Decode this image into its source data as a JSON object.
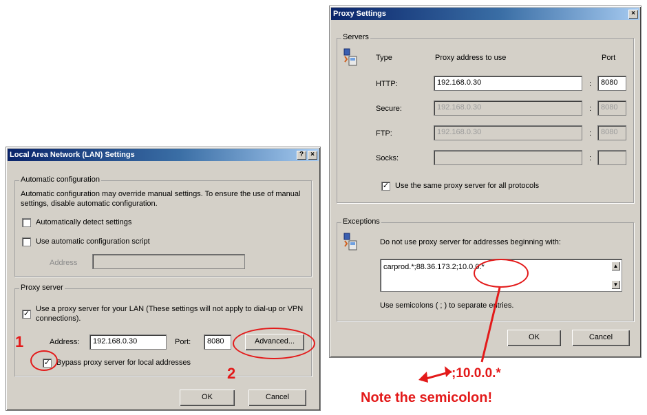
{
  "lan_dialog": {
    "title": "Local Area Network (LAN) Settings",
    "help_btn": "?",
    "close_btn": "×",
    "auto_config": {
      "group_label": "Automatic configuration",
      "description": "Automatic configuration may override manual settings.  To ensure the use of manual settings, disable automatic configuration.",
      "auto_detect_label": "Automatically detect settings",
      "auto_detect_checked": false,
      "use_script_label": "Use automatic configuration script",
      "use_script_checked": false,
      "address_label": "Address",
      "address_value": ""
    },
    "proxy_server": {
      "group_label": "Proxy server",
      "use_proxy_label": "Use a proxy server for your LAN (These settings will not apply to dial-up or VPN connections).",
      "use_proxy_checked": true,
      "address_label": "Address:",
      "address_value": "192.168.0.30",
      "port_label": "Port:",
      "port_value": "8080",
      "advanced_button": "Advanced...",
      "bypass_label": "Bypass proxy server for local addresses",
      "bypass_checked": true
    },
    "ok_button": "OK",
    "cancel_button": "Cancel"
  },
  "proxy_dialog": {
    "title": "Proxy Settings",
    "close_btn": "×",
    "servers": {
      "group_label": "Servers",
      "col_type": "Type",
      "col_address": "Proxy address to use",
      "col_port": "Port",
      "rows": [
        {
          "type": "HTTP:",
          "address": "192.168.0.30",
          "port": "8080",
          "disabled": false
        },
        {
          "type": "Secure:",
          "address": "192.168.0.30",
          "port": "8080",
          "disabled": true
        },
        {
          "type": "FTP:",
          "address": "192.168.0.30",
          "port": "8080",
          "disabled": true
        },
        {
          "type": "Socks:",
          "address": "",
          "port": "",
          "disabled": true
        }
      ],
      "colon": ":",
      "same_proxy_label": "Use the same proxy server for all protocols",
      "same_proxy_checked": true
    },
    "exceptions": {
      "group_label": "Exceptions",
      "description": "Do not use proxy server for addresses beginning with:",
      "value": "carprod.*;88.36.173.2;10.0.0.*",
      "hint": "Use semicolons ( ; ) to separate entries."
    },
    "ok_button": "OK",
    "cancel_button": "Cancel"
  },
  "annotations": {
    "step1": "1",
    "step2": "2",
    "callout_value": ";10.0.0.*",
    "note": "Note the semicolon!",
    "color": "#e31a1a"
  }
}
